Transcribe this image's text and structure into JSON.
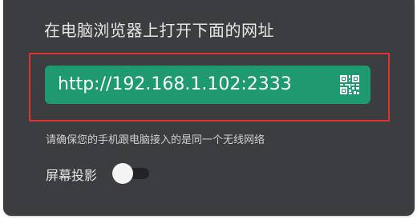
{
  "dialog": {
    "title": "在电脑浏览器上打开下面的网址",
    "url": "http://192.168.1.102:2333",
    "url_icon": "qr-code-icon",
    "hint": "请确保您的手机跟电脑接入的是同一个无线网络",
    "screen_projection": {
      "label": "屏幕投影",
      "enabled": false
    }
  },
  "colors": {
    "background": "#3c3d40",
    "url_bar": "#1f9a70",
    "highlight": "#e0322f"
  }
}
